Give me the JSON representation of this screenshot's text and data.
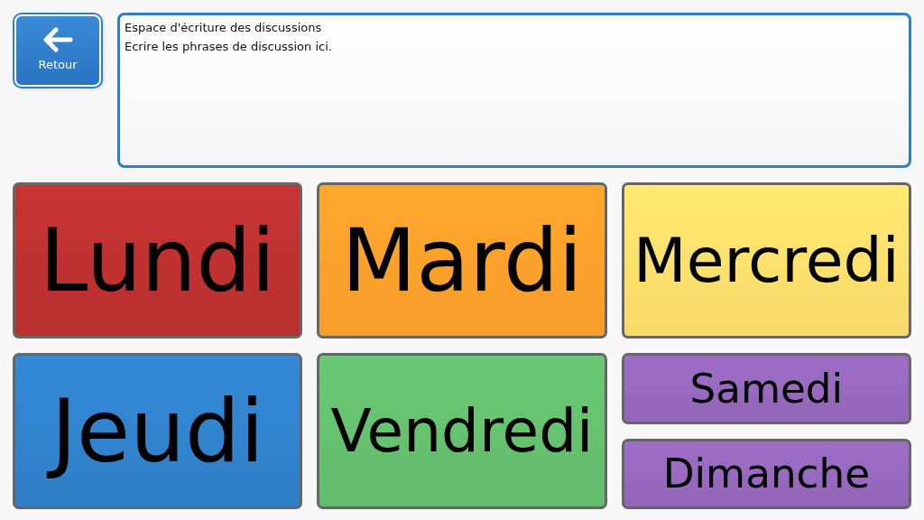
{
  "back_button": {
    "label": "Retour"
  },
  "discussion_area": {
    "value": "Espace d'écriture des discussions\nEcrire les phrases de discussion ici."
  },
  "tiles": [
    {
      "label": "Lundi",
      "kind": "tall",
      "color": "#b8302f"
    },
    {
      "label": "Mardi",
      "kind": "tall",
      "color": "#f89c2a"
    },
    {
      "label": "Mercredi",
      "kind": "tall",
      "color": "#f7d96a"
    },
    {
      "label": "Jeudi",
      "kind": "tall",
      "color": "#2f7fc6"
    },
    {
      "label": "Vendredi",
      "kind": "tall",
      "color": "#62bb6b"
    },
    {
      "label": "Samedi",
      "kind": "short",
      "color": "#9266b8"
    },
    {
      "label": "Dimanche",
      "kind": "short",
      "color": "#9266b8"
    }
  ]
}
